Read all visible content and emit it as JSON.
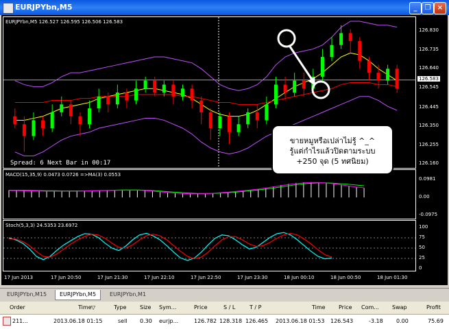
{
  "window": {
    "title": "EURJPYbn,M5",
    "buttons": {
      "minimize": "_",
      "restore": "❐",
      "close": "×"
    }
  },
  "chart_data": [
    {
      "type": "candlestick",
      "title": "EURJPYbn,M5  126.527 126.595 126.506 126.583",
      "ylim": [
        126.16,
        126.88
      ],
      "y_ticks": [
        "126.830",
        "126.735",
        "126.640",
        "126.545",
        "126.445",
        "126.350",
        "126.255",
        "126.160"
      ],
      "current_price_label": "126.583",
      "overlay_text": "Spread: 6   Next Bar in 00:17",
      "x_ticks": [
        "17 Jun 2013",
        "17 Jun 20:50",
        "17 Jun 21:30",
        "17 Jun 22:10",
        "17 Jun 22:50",
        "17 Jun 23:30",
        "18 Jun 00:10",
        "18 Jun 00:50",
        "18 Jun 01:30"
      ],
      "candles": [
        [
          126.4,
          126.36,
          126.44,
          126.34
        ],
        [
          126.36,
          126.3,
          126.4,
          126.22
        ],
        [
          126.3,
          126.38,
          126.42,
          126.28
        ],
        [
          126.38,
          126.34,
          126.4,
          126.3
        ],
        [
          126.34,
          126.42,
          126.46,
          126.32
        ],
        [
          126.42,
          126.46,
          126.5,
          126.4
        ],
        [
          126.46,
          126.4,
          126.48,
          126.36
        ],
        [
          126.4,
          126.36,
          126.42,
          126.3
        ],
        [
          126.36,
          126.44,
          126.48,
          126.34
        ],
        [
          126.44,
          126.5,
          126.54,
          126.42
        ],
        [
          126.5,
          126.46,
          126.52,
          126.42
        ],
        [
          126.46,
          126.52,
          126.56,
          126.44
        ],
        [
          126.52,
          126.48,
          126.54,
          126.44
        ],
        [
          126.48,
          126.54,
          126.58,
          126.46
        ],
        [
          126.54,
          126.58,
          126.6,
          126.52
        ],
        [
          126.58,
          126.52,
          126.6,
          126.5
        ],
        [
          126.52,
          126.56,
          126.58,
          126.5
        ],
        [
          126.56,
          126.5,
          126.58,
          126.46
        ],
        [
          126.5,
          126.54,
          126.56,
          126.48
        ],
        [
          126.54,
          126.48,
          126.56,
          126.44
        ],
        [
          126.48,
          126.42,
          126.5,
          126.36
        ],
        [
          126.42,
          126.34,
          126.44,
          126.28
        ],
        [
          126.34,
          126.4,
          126.42,
          126.3
        ],
        [
          126.4,
          126.32,
          126.42,
          126.26
        ],
        [
          126.32,
          126.36,
          126.4,
          126.3
        ],
        [
          126.36,
          126.42,
          126.44,
          126.34
        ],
        [
          126.42,
          126.38,
          126.46,
          126.34
        ],
        [
          126.38,
          126.46,
          126.5,
          126.36
        ],
        [
          126.46,
          126.56,
          126.6,
          126.44
        ],
        [
          126.56,
          126.52,
          126.6,
          126.48
        ],
        [
          126.52,
          126.58,
          126.62,
          126.5
        ],
        [
          126.58,
          126.54,
          126.62,
          126.5
        ],
        [
          126.54,
          126.6,
          126.64,
          126.52
        ],
        [
          126.6,
          126.7,
          126.74,
          126.58
        ],
        [
          126.7,
          126.76,
          126.8,
          126.68
        ],
        [
          126.76,
          126.82,
          126.86,
          126.74
        ],
        [
          126.82,
          126.78,
          126.84,
          126.72
        ],
        [
          126.78,
          126.68,
          126.8,
          126.64
        ],
        [
          126.68,
          126.62,
          126.7,
          126.58
        ],
        [
          126.62,
          126.58,
          126.66,
          126.54
        ],
        [
          126.58,
          126.64,
          126.66,
          126.56
        ],
        [
          126.64,
          126.54,
          126.66,
          126.52
        ]
      ],
      "lines": [
        {
          "name": "MA fast",
          "color": "#ffff00",
          "values": [
            126.38,
            126.38,
            126.39,
            126.4,
            126.42,
            126.44,
            126.45,
            126.46,
            126.47,
            126.49,
            126.5,
            126.51,
            126.52,
            126.53,
            126.54,
            126.54,
            126.53,
            126.52,
            126.51,
            126.49,
            126.46,
            126.43,
            126.41,
            126.4,
            126.4,
            126.41,
            126.43,
            126.46,
            126.49,
            126.52,
            126.55,
            126.57,
            126.59,
            126.62,
            126.66,
            126.7,
            126.72,
            126.71,
            126.68,
            126.64,
            126.61,
            126.58
          ]
        },
        {
          "name": "MA slow",
          "color": "#ff0000",
          "values": [
            126.47,
            126.47,
            126.47,
            126.47,
            126.48,
            126.48,
            126.48,
            126.49,
            126.49,
            126.5,
            126.5,
            126.5,
            126.5,
            126.51,
            126.51,
            126.51,
            126.51,
            126.51,
            126.5,
            126.5,
            126.49,
            126.48,
            126.47,
            126.47,
            126.46,
            126.46,
            126.46,
            126.47,
            126.48,
            126.49,
            126.5,
            126.51,
            126.52,
            126.53,
            126.54,
            126.56,
            126.57,
            126.57,
            126.57,
            126.56,
            126.56,
            126.55
          ]
        },
        {
          "name": "Band upper",
          "color": "#c050ff",
          "values": [
            126.58,
            126.56,
            126.55,
            126.55,
            126.57,
            126.6,
            126.62,
            126.62,
            126.63,
            126.64,
            126.65,
            126.66,
            126.67,
            126.68,
            126.69,
            126.7,
            126.7,
            126.69,
            126.68,
            126.67,
            126.64,
            126.6,
            126.56,
            126.54,
            126.53,
            126.54,
            126.56,
            126.6,
            126.66,
            126.7,
            126.72,
            126.73,
            126.74,
            126.76,
            126.8,
            126.85,
            126.88,
            126.88,
            126.87,
            126.86,
            126.86,
            126.85
          ]
        },
        {
          "name": "Band lower",
          "color": "#c050ff",
          "values": [
            126.22,
            126.2,
            126.2,
            126.22,
            126.25,
            126.28,
            126.3,
            126.31,
            126.32,
            126.34,
            126.35,
            126.36,
            126.37,
            126.38,
            126.39,
            126.39,
            126.38,
            126.36,
            126.34,
            126.31,
            126.27,
            126.24,
            126.22,
            126.21,
            126.22,
            126.24,
            126.27,
            126.3,
            126.32,
            126.34,
            126.36,
            126.38,
            126.4,
            126.42,
            126.44,
            126.46,
            126.48,
            126.5,
            126.5,
            126.48,
            126.45,
            126.43
          ]
        }
      ]
    },
    {
      "type": "histogram",
      "title": "MACD(15,35,9) 0.0473 0.0726 =>MA(3) 0.0553",
      "ylim": [
        -0.0975,
        0.0981
      ],
      "y_ticks": [
        "0.0981",
        "0.00",
        "-0.0975"
      ],
      "values": [
        0.0,
        0.0,
        0.0,
        0.0,
        0.0,
        0.0,
        0.0,
        0.0,
        0.0,
        0.0,
        0.0,
        0.0,
        0.0,
        0.0,
        0.0,
        0.0,
        0.0,
        0.0,
        0.0,
        0.0,
        0.0,
        0.0,
        0.0,
        0.0,
        0.0,
        0.0,
        0.0,
        0.0,
        0.0,
        0.0,
        0.0,
        0.0,
        0.0,
        0.0,
        0.0,
        0.0,
        0.0,
        0.0,
        0.0,
        0.0,
        0.0,
        0.0,
        0.0,
        0.0,
        0.0,
        0.0,
        0.0,
        0.0,
        0.0,
        0.0,
        0.0,
        0.0,
        0.0,
        0.0,
        0.0,
        0.0,
        0.0,
        0.0,
        0.0,
        0.0,
        0.0,
        0.0,
        0.0,
        0.0,
        0.0,
        0.0,
        0.0,
        0.0,
        0.0,
        0.0,
        0.0,
        0.0,
        0.0,
        0.0,
        0.0,
        0.0,
        0.0,
        0.0,
        0.0,
        0.0,
        0.0,
        0.0,
        0.0,
        0.0,
        0.0,
        0.0,
        0.0,
        0.0,
        0.0,
        0.0,
        0.0,
        0.0,
        0.0,
        0.0,
        0.0,
        0.0,
        0.0,
        0.0,
        0.0,
        0.0,
        0.0,
        0.0,
        0.0,
        0.0,
        0.0,
        0.0,
        0.0,
        0.0,
        0.0,
        0.0,
        0.0,
        0.0,
        0.0,
        0.0,
        0.0,
        0.0,
        0.0,
        0.0,
        0.0,
        0.0,
        0.0,
        0.0,
        0.0,
        0.0,
        0.0,
        0.0,
        0.0,
        0.0
      ],
      "bars": [
        0.04,
        0.04,
        0.039,
        0.038,
        0.037,
        0.036,
        0.036,
        0.036,
        0.036,
        0.036,
        0.037,
        0.038,
        0.039,
        0.04,
        0.041,
        0.042,
        0.042,
        0.041,
        0.039,
        0.036,
        0.032,
        0.028,
        0.025,
        0.022,
        0.02,
        0.02,
        0.021,
        0.023,
        0.026,
        0.03,
        0.034,
        0.038,
        0.042,
        0.047,
        0.053,
        0.06,
        0.068,
        0.075,
        0.08,
        0.083,
        0.084,
        0.083,
        0.08,
        0.076,
        0.07,
        0.064,
        0.058,
        0.052
      ],
      "signal": [
        0.04,
        0.04,
        0.04,
        0.039,
        0.038,
        0.037,
        0.037,
        0.036,
        0.036,
        0.036,
        0.036,
        0.037,
        0.038,
        0.039,
        0.04,
        0.041,
        0.041,
        0.041,
        0.04,
        0.038,
        0.035,
        0.032,
        0.029,
        0.026,
        0.024,
        0.022,
        0.022,
        0.022,
        0.024,
        0.026,
        0.029,
        0.033,
        0.037,
        0.041,
        0.046,
        0.051,
        0.058,
        0.064,
        0.07,
        0.075,
        0.078,
        0.08,
        0.08,
        0.078,
        0.075,
        0.072,
        0.068,
        0.064
      ],
      "ma": [
        0.038,
        0.038,
        0.037,
        0.036,
        0.035,
        0.034,
        0.034,
        0.034,
        0.034,
        0.034,
        0.035,
        0.036,
        0.037,
        0.038,
        0.039,
        0.04,
        0.04,
        0.04,
        0.038,
        0.035,
        0.031,
        0.027,
        0.024,
        0.022,
        0.02,
        0.02,
        0.021,
        0.023,
        0.026,
        0.029,
        0.033,
        0.037,
        0.041,
        0.046,
        0.052,
        0.058,
        0.065,
        0.071,
        0.076,
        0.08,
        0.082,
        0.082,
        0.079,
        0.075,
        0.069,
        0.063,
        0.057,
        0.053
      ]
    },
    {
      "type": "line",
      "title": "Stoch(5,3,3) 24.5353 23.6972",
      "ylim": [
        0,
        100
      ],
      "y_ticks": [
        "100",
        "75",
        "50",
        "25",
        "0"
      ],
      "series": [
        {
          "name": "main",
          "color": "#00ffff",
          "values": [
            75,
            70,
            62,
            48,
            30,
            22,
            30,
            45,
            58,
            68,
            78,
            85,
            84,
            76,
            62,
            50,
            44,
            55,
            70,
            82,
            86,
            80,
            70,
            56,
            40,
            26,
            20,
            26,
            40,
            58,
            74,
            82,
            80,
            70,
            58,
            48,
            52,
            64,
            76,
            85,
            88,
            82,
            70,
            56,
            42,
            30,
            24,
            26
          ]
        },
        {
          "name": "signal",
          "color": "#ff0000",
          "values": [
            72,
            72,
            66,
            56,
            42,
            30,
            28,
            36,
            48,
            60,
            70,
            78,
            84,
            82,
            74,
            62,
            52,
            50,
            58,
            70,
            80,
            84,
            80,
            70,
            56,
            42,
            30,
            24,
            28,
            40,
            56,
            70,
            78,
            78,
            70,
            60,
            54,
            56,
            64,
            74,
            82,
            86,
            82,
            72,
            60,
            46,
            34,
            28
          ]
        }
      ]
    }
  ],
  "callout": {
    "line1": "ขายหมูหรือเปล่าไม่รู้ ^_^",
    "line2": "รู้แต่กำไรแล้วปิดตามระบบ",
    "line3": "+250 จุด (5 ทศนิยม)"
  },
  "tabs": [
    "EURJPYbn,M15",
    "EURJPYbn,M5",
    "EURJPYbn,M1"
  ],
  "active_tab": 1,
  "table": {
    "headers": [
      "Order",
      "Time",
      "Type",
      "Size",
      "Sym...",
      "Price",
      "S / L",
      "T / P",
      "Time",
      "Price",
      "Com...",
      "Swap",
      "Profit"
    ],
    "row": [
      "211...",
      "2013.06.18 01:15",
      "sell",
      "0.30",
      "eurjp...",
      "126.782",
      "128.318",
      "126.465",
      "2013.06.18 01:53",
      "126.543",
      "-3.18",
      "0.00",
      "75.69"
    ]
  },
  "colors": {
    "bull": "#00ff00",
    "bear": "#ff0000",
    "grid": "#ffffff",
    "background": "#000000"
  }
}
